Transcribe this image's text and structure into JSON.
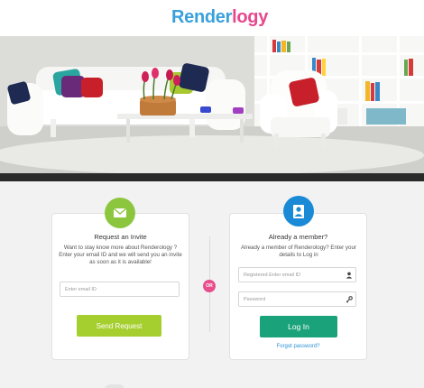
{
  "brand": {
    "logo_part1": "Render",
    "logo_part2": "logy"
  },
  "request": {
    "title": "Request an Invite",
    "description": "Want to stay know more about Renderology ? Enter your email ID and we will send you an invite as soon as it is available!",
    "email_placeholder": "Enter email ID",
    "button_label": "Send Request",
    "icon": "envelope-icon"
  },
  "or_label": "OR",
  "login": {
    "title": "Already a member?",
    "description": "Already a member of Renderology? Enter your details to Log in",
    "email_placeholder": "Registered Enter email ID",
    "password_placeholder": "Password",
    "button_label": "Log In",
    "forgot_label": "Forgot password?",
    "icon": "user-icon"
  },
  "colors": {
    "brand_blue": "#3aa0dc",
    "brand_pink": "#e6478d",
    "request_green": "#8cc63f",
    "send_button": "#a5cf2e",
    "member_blue": "#1a8ad6",
    "login_button": "#1aa37a",
    "or_pink": "#e84e8c"
  }
}
